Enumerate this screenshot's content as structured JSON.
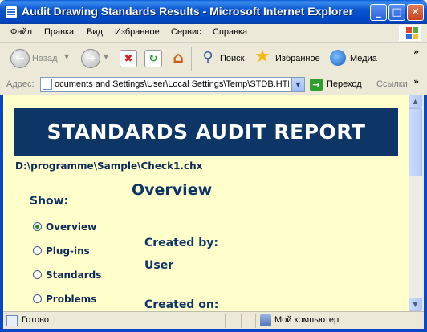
{
  "window": {
    "title": "Audit Drawing Standards Results - Microsoft Internet Explorer",
    "min_glyph": "_",
    "max_glyph": "□",
    "close_glyph": "✕"
  },
  "menu": [
    "Файл",
    "Правка",
    "Вид",
    "Избранное",
    "Сервис",
    "Справка"
  ],
  "toolbar": {
    "back_label": "Назад",
    "search_label": "Поиск",
    "favorites_label": "Избранное",
    "media_label": "Медиа"
  },
  "address": {
    "label": "Адрес:",
    "value": "ocuments and Settings\\User\\Local Settings\\Temp\\STDB.HTM",
    "go_label": "Переход",
    "links_label": "Ссылки"
  },
  "report": {
    "banner": "STANDARDS AUDIT REPORT",
    "file_path": "D:\\programme\\Sample\\Check1.chx",
    "section_title": "Overview",
    "show_label": "Show:",
    "options": [
      {
        "label": "Overview",
        "checked": true
      },
      {
        "label": "Plug-ins",
        "checked": false
      },
      {
        "label": "Standards",
        "checked": false
      },
      {
        "label": "Problems",
        "checked": false
      }
    ],
    "created_by_label": "Created by:",
    "created_by_value": "User",
    "created_on_label": "Created on:"
  },
  "status": {
    "text": "Готово",
    "zone": "Мой компьютер"
  },
  "colors": {
    "banner_bg": "#0d3566",
    "page_bg": "#ffffcc",
    "titlebar": "#0a56d0"
  }
}
